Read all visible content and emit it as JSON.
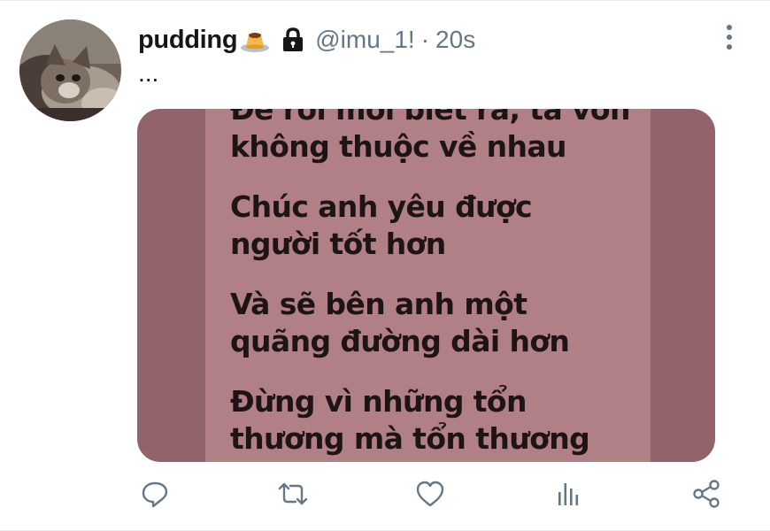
{
  "tweet": {
    "display_name": "pudding",
    "name_emoji": "pudding-emoji",
    "protected_icon": "lock-icon",
    "handle": "@imu_1!",
    "separator": "·",
    "time": "20s",
    "text": "...",
    "avatar_alt": "cat avatar"
  },
  "media": {
    "lyrics": [
      [
        "Để rồi mới biết ra, ta vốn",
        "không thuộc về nhau"
      ],
      [
        "Chúc anh yêu được",
        "người tốt hơn"
      ],
      [
        "Và sẽ bên anh một",
        "quãng đường dài hơn"
      ],
      [
        "Đừng vì những tổn",
        "thương mà tổn thương"
      ]
    ]
  },
  "actions": {
    "reply_icon": "reply-icon",
    "retweet_icon": "retweet-icon",
    "like_icon": "heart-icon",
    "analytics_icon": "analytics-icon",
    "share_icon": "share-icon"
  },
  "colors": {
    "text": "#14171a",
    "secondary": "#657786",
    "icon": "#657786",
    "media_bg": "#b17f86",
    "media_side": "#93636b"
  }
}
